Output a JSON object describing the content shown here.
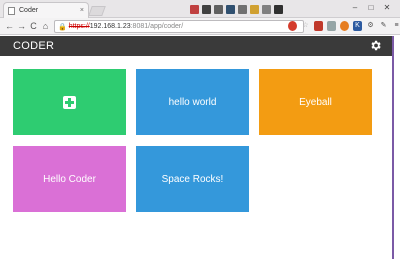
{
  "browser": {
    "tab_title": "Coder",
    "tab_close": "×",
    "url_scheme": "https://",
    "url_host": "192.168.1.23",
    "url_path": ":8081/app/coder/",
    "nav": {
      "back": "←",
      "forward": "→",
      "reload": "C",
      "home": "⌂"
    },
    "window_controls": {
      "minimize": "–",
      "maximize": "□",
      "close": "✕"
    },
    "menu_icon": "≡",
    "swatch_colors": [
      "#c04040",
      "#404040",
      "#606060",
      "#305070",
      "#707070",
      "#d0a030",
      "#808080",
      "#303030"
    ],
    "extensions": [
      {
        "icon": "stop-icon",
        "color": "#d43c2c"
      },
      {
        "icon": "star-icon",
        "color": "#cccccc"
      },
      {
        "icon": "bookmark-icon",
        "color": "#c0392b"
      },
      {
        "icon": "puzzle-icon",
        "color": "#7f8c8d"
      },
      {
        "icon": "smile-icon",
        "color": "#e67e22"
      },
      {
        "icon": "k-icon",
        "color": "#2c5aa0"
      },
      {
        "icon": "gear-ext-icon",
        "color": "#555555"
      },
      {
        "icon": "extension-icon",
        "color": "#444444"
      }
    ]
  },
  "app": {
    "title": "CODER",
    "settings_icon": "gear-icon"
  },
  "tiles": [
    {
      "label": "",
      "icon": "plus-icon",
      "color": "#2ecc71"
    },
    {
      "label": "hello world",
      "color": "#3498db"
    },
    {
      "label": "Eyeball",
      "color": "#f39c12"
    },
    {
      "label": "Hello Coder",
      "color": "#da70d6"
    },
    {
      "label": "Space Rocks!",
      "color": "#3498db"
    }
  ],
  "watermark": "Ⓟ"
}
